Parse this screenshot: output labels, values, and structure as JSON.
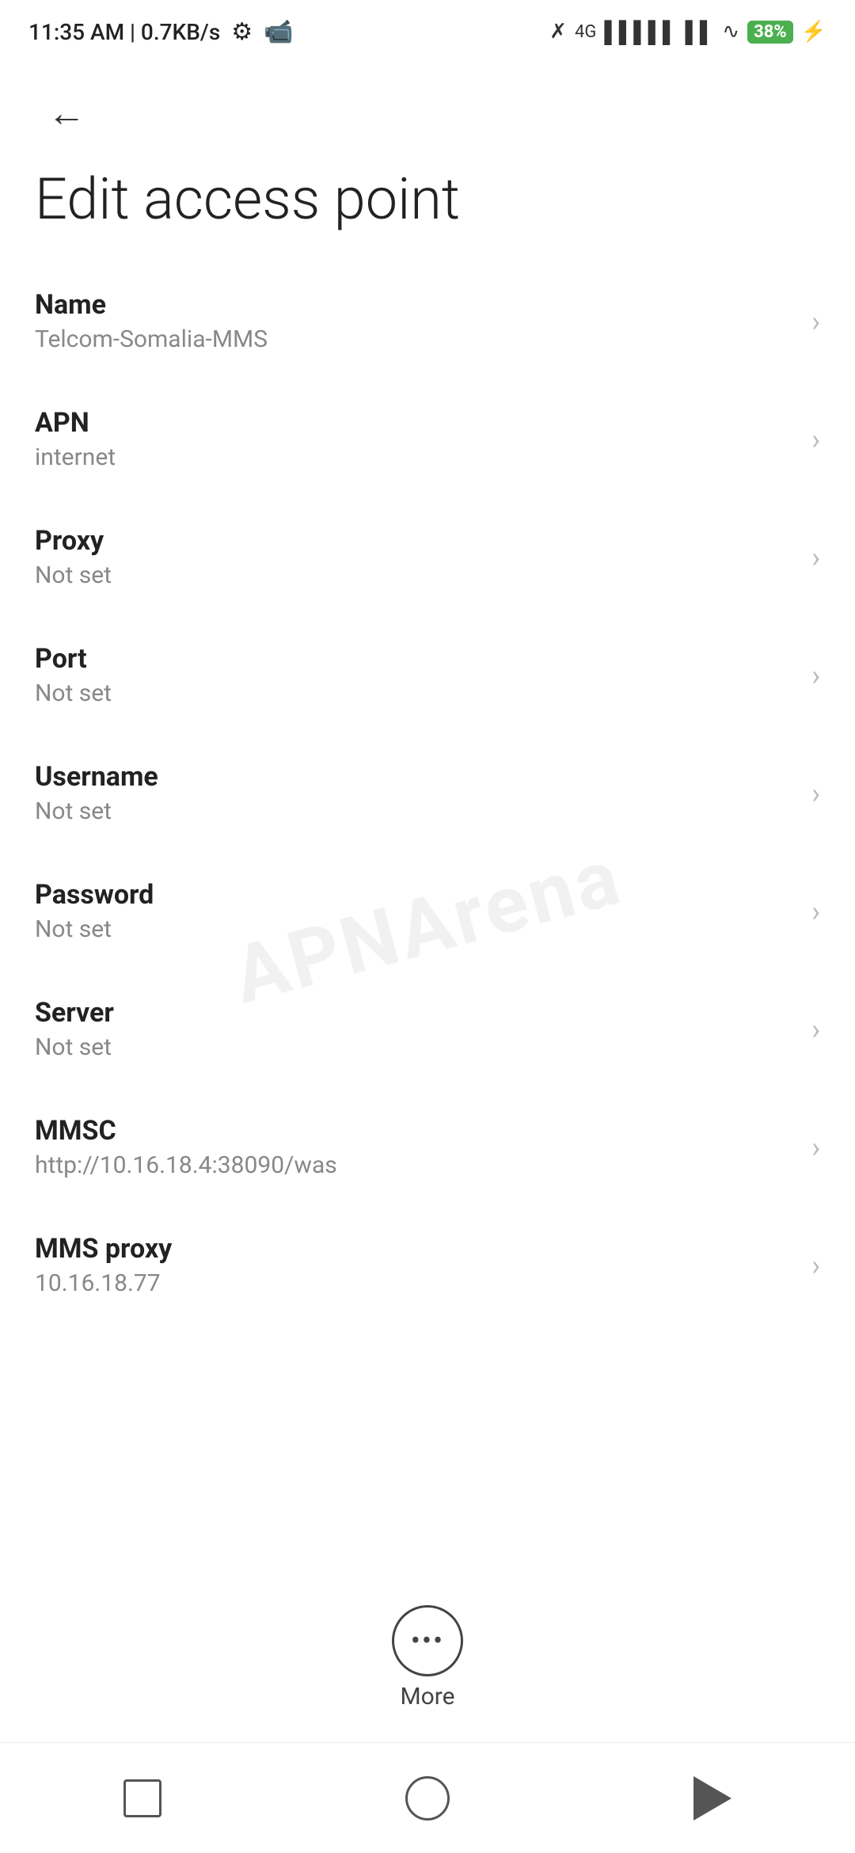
{
  "status_bar": {
    "time": "11:35 AM | 0.7KB/s",
    "battery_level": "38"
  },
  "header": {
    "back_label": "←",
    "title": "Edit access point"
  },
  "settings_items": [
    {
      "label": "Name",
      "value": "Telcom-Somalia-MMS"
    },
    {
      "label": "APN",
      "value": "internet"
    },
    {
      "label": "Proxy",
      "value": "Not set"
    },
    {
      "label": "Port",
      "value": "Not set"
    },
    {
      "label": "Username",
      "value": "Not set"
    },
    {
      "label": "Password",
      "value": "Not set"
    },
    {
      "label": "Server",
      "value": "Not set"
    },
    {
      "label": "MMSC",
      "value": "http://10.16.18.4:38090/was"
    },
    {
      "label": "MMS proxy",
      "value": "10.16.18.77"
    }
  ],
  "more_button": {
    "label": "More"
  },
  "bottom_nav": {
    "square_label": "recent-apps",
    "circle_label": "home",
    "triangle_label": "back"
  },
  "watermark": "APNArena"
}
